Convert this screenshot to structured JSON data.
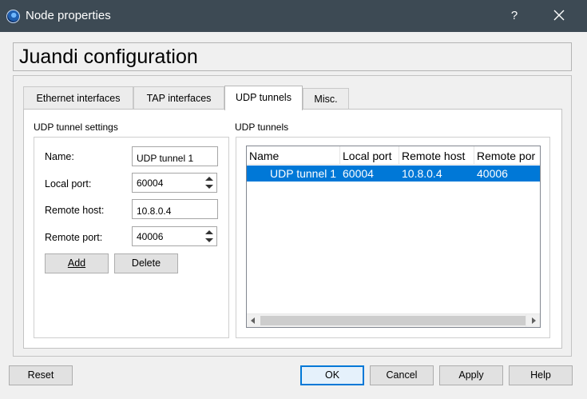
{
  "window": {
    "title": "Node properties",
    "help_label": "?",
    "close_icon": "close-icon"
  },
  "config_title": "Juandi configuration",
  "tabs": [
    {
      "label": "Ethernet interfaces",
      "active": false
    },
    {
      "label": "TAP interfaces",
      "active": false
    },
    {
      "label": "UDP tunnels",
      "active": true
    },
    {
      "label": "Misc.",
      "active": false
    }
  ],
  "settings": {
    "group_label": "UDP tunnel settings",
    "name_label": "Name:",
    "name_value": "UDP tunnel 1",
    "local_port_label": "Local port:",
    "local_port_value": "60004",
    "remote_host_label": "Remote host:",
    "remote_host_value": "10.8.0.4",
    "remote_port_label": "Remote port:",
    "remote_port_value": "40006",
    "add_label": "Add",
    "delete_label": "Delete"
  },
  "tunnels": {
    "group_label": "UDP tunnels",
    "columns": [
      "Name",
      "Local port",
      "Remote host",
      "Remote por"
    ],
    "rows": [
      {
        "name": "UDP tunnel 1",
        "local_port": "60004",
        "remote_host": "10.8.0.4",
        "remote_port": "40006",
        "selected": true
      }
    ]
  },
  "footer": {
    "reset_label": "Reset",
    "ok_label": "OK",
    "cancel_label": "Cancel",
    "apply_label": "Apply",
    "help_label": "Help"
  },
  "colors": {
    "titlebar": "#3d4a54",
    "selection": "#0078d7"
  }
}
